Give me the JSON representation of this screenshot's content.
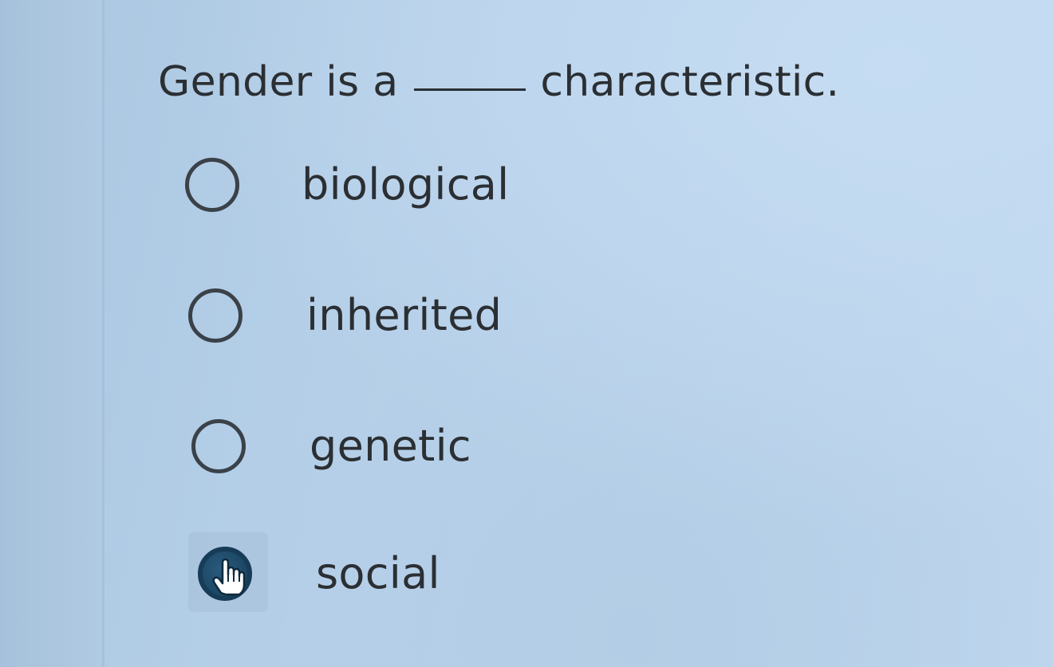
{
  "question": {
    "prefix": "Gender is a",
    "suffix": "characteristic."
  },
  "options": [
    {
      "label": "biological",
      "selected": false
    },
    {
      "label": "inherited",
      "selected": false
    },
    {
      "label": "genetic",
      "selected": false
    },
    {
      "label": "social",
      "selected": true
    }
  ],
  "cursor_icon": "hand-pointer-icon",
  "colors": {
    "background": "#b8d1ea",
    "text": "#2b2f33",
    "radio_border": "#3a4148",
    "radio_selected": "#1c4664"
  }
}
